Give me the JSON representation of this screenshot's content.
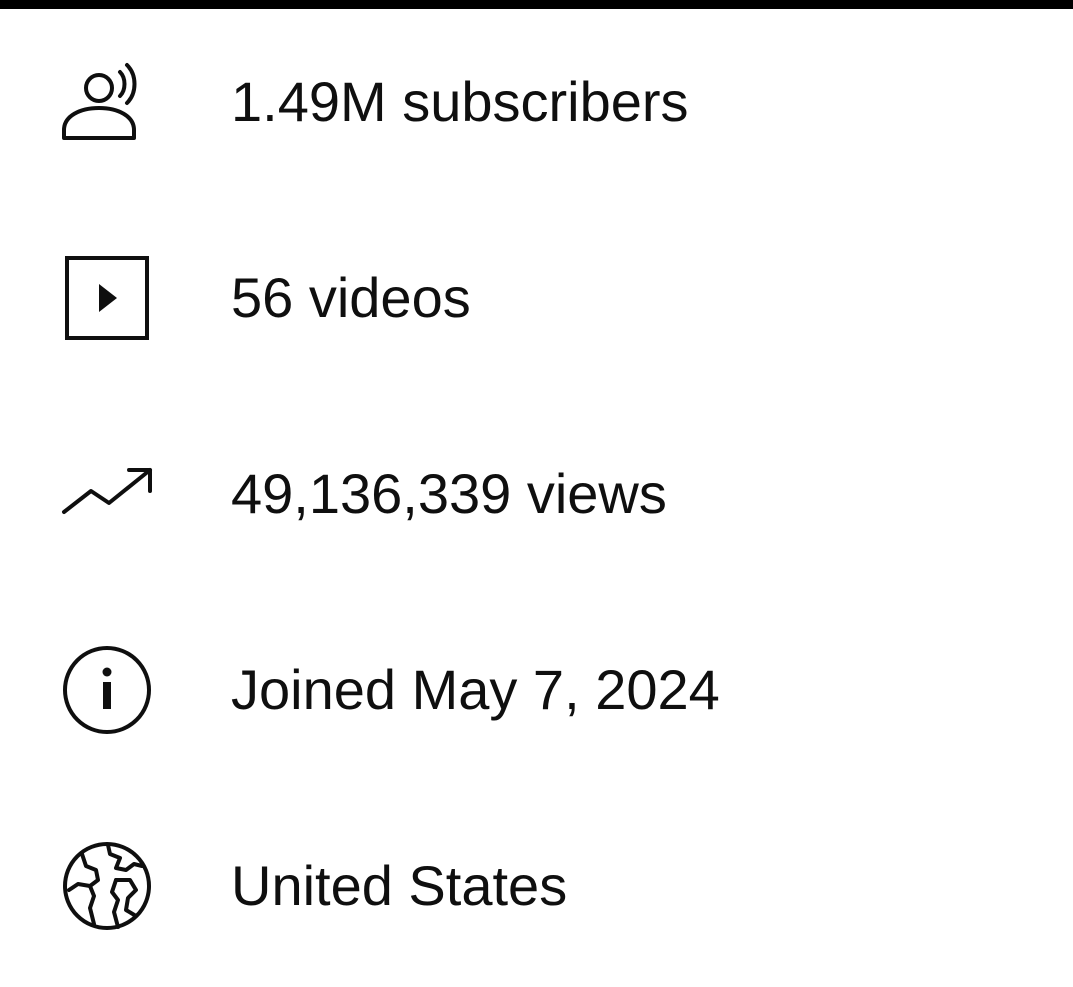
{
  "channel_about": {
    "items": [
      {
        "icon": "subscribers-icon",
        "text": "1.49M subscribers"
      },
      {
        "icon": "video-play-icon",
        "text": "56 videos"
      },
      {
        "icon": "trending-up-icon",
        "text": "49,136,339 views"
      },
      {
        "icon": "info-icon",
        "text": "Joined May 7, 2024"
      },
      {
        "icon": "globe-icon",
        "text": "United States"
      }
    ]
  },
  "colors": {
    "text": "#0f0f0f",
    "icon": "#0f0f0f",
    "background": "#ffffff",
    "top_bar": "#000000"
  }
}
